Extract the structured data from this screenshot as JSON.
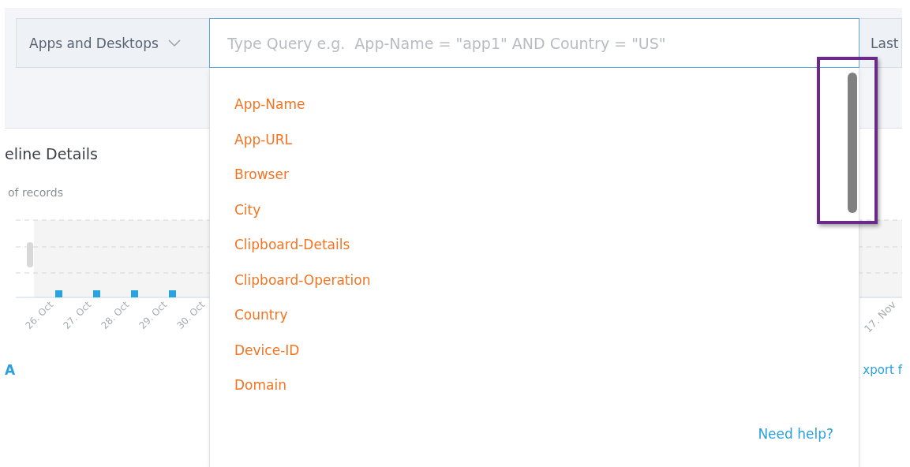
{
  "filter_bar": {
    "category": "Apps and Desktops",
    "query": {
      "placeholder": "Type Query e.g.  App-Name = \"app1\" AND Country = \"US\""
    },
    "time_range": "Last"
  },
  "suggestions": {
    "expanded": true,
    "items": [
      {
        "label": "App-Name"
      },
      {
        "label": "App-URL"
      },
      {
        "label": "Browser"
      },
      {
        "label": "City"
      },
      {
        "label": "Clipboard-Details"
      },
      {
        "label": "Clipboard-Operation"
      },
      {
        "label": "Country"
      },
      {
        "label": "Device-ID"
      },
      {
        "label": "Domain"
      }
    ],
    "help_link": "Need help?",
    "highlighted_scrollbar": true
  },
  "timeline": {
    "title": "eline Details",
    "ylabel": "of records",
    "x_labels": [
      {
        "label": "26. Oct",
        "marked": true
      },
      {
        "label": "27. Oct",
        "marked": true
      },
      {
        "label": "28. Oct",
        "marked": true
      },
      {
        "label": "29. Oct",
        "marked": true
      },
      {
        "label": "30. Oct",
        "marked": false
      }
    ],
    "x_labels_right": [
      "17. Nov"
    ]
  },
  "footer": {
    "left_link": "A",
    "right_link": "xport f"
  }
}
